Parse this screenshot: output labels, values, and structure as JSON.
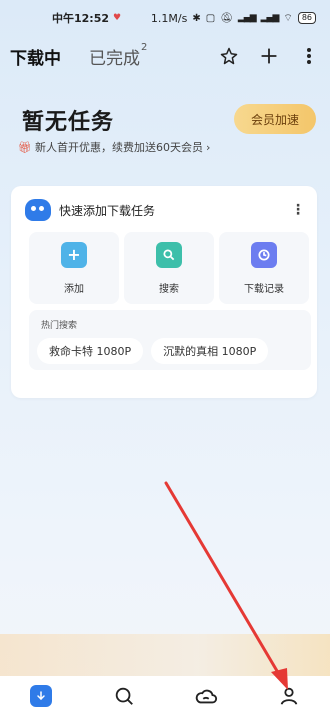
{
  "status_bar": {
    "time": "中午12:52",
    "net_speed": "1.1M/s",
    "battery": "86"
  },
  "top_nav": {
    "tab_downloading": "下载中",
    "tab_completed": "已完成",
    "completed_count": "2"
  },
  "hero": {
    "title": "暂无任务",
    "promo": "新人首开优惠，续费加送60天会员",
    "vip_button": "会员加速"
  },
  "quick_card": {
    "title": "快速添加下载任务",
    "tiles": [
      {
        "label": "添加",
        "icon": "plus-icon",
        "color": "#4fb3e8"
      },
      {
        "label": "搜索",
        "icon": "search-icon",
        "color": "#3dbfaa"
      },
      {
        "label": "下载记录",
        "icon": "clock-icon",
        "color": "#6c7df0"
      }
    ],
    "hot_title": "热门搜索",
    "hot_items": [
      "救命卡特 1080P",
      "沉默的真相 1080P"
    ]
  },
  "bottom_nav": {
    "items": [
      "download-icon",
      "search-icon",
      "cloud-icon",
      "profile-icon"
    ]
  },
  "accent": "#2f7be8",
  "annotation_arrow_color": "#e53935"
}
